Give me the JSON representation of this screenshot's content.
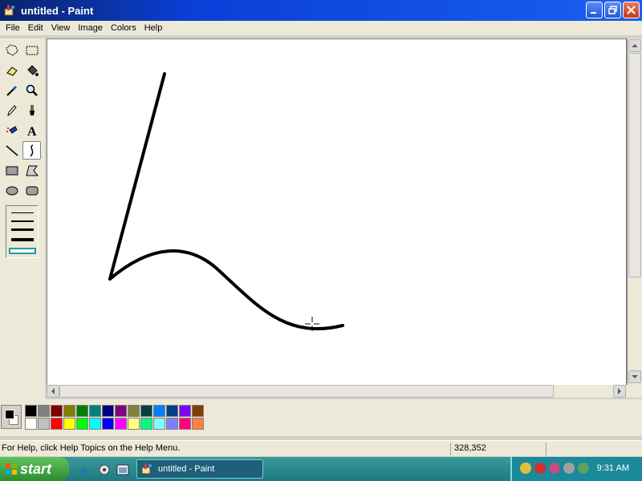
{
  "window": {
    "title": "untitled - Paint"
  },
  "menu": [
    "File",
    "Edit",
    "View",
    "Image",
    "Colors",
    "Help"
  ],
  "tools": [
    {
      "name": "free-form-select-icon"
    },
    {
      "name": "select-icon"
    },
    {
      "name": "eraser-icon"
    },
    {
      "name": "fill-icon"
    },
    {
      "name": "pick-color-icon"
    },
    {
      "name": "magnifier-icon"
    },
    {
      "name": "pencil-icon"
    },
    {
      "name": "brush-icon"
    },
    {
      "name": "airbrush-icon"
    },
    {
      "name": "text-icon"
    },
    {
      "name": "line-icon"
    },
    {
      "name": "curve-icon"
    },
    {
      "name": "rectangle-icon"
    },
    {
      "name": "polygon-icon"
    },
    {
      "name": "ellipse-icon"
    },
    {
      "name": "rounded-rectangle-icon"
    }
  ],
  "active_tool": "curve-icon",
  "palette": {
    "foreground": "#000000",
    "background": "#ffffff",
    "row1": [
      "#000000",
      "#808080",
      "#800000",
      "#808000",
      "#008000",
      "#008080",
      "#000080",
      "#800080",
      "#808040",
      "#004040",
      "#0080ff",
      "#004080",
      "#8000ff",
      "#804000"
    ],
    "row2": [
      "#ffffff",
      "#c0c0c0",
      "#ff0000",
      "#ffff00",
      "#00ff00",
      "#00ffff",
      "#0000ff",
      "#ff00ff",
      "#ffff80",
      "#00ff80",
      "#80ffff",
      "#8080ff",
      "#ff0080",
      "#ff8040"
    ]
  },
  "status": {
    "help_text": "For Help, click Help Topics on the Help Menu.",
    "coords": "328,352"
  },
  "taskbar": {
    "start_label": "start",
    "task_label": "untitled - Paint",
    "clock": "9:31 AM"
  }
}
